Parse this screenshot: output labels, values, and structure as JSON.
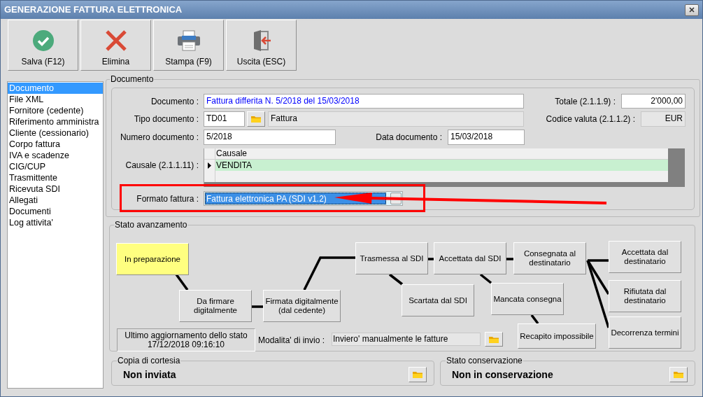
{
  "window": {
    "title": "GENERAZIONE FATTURA ELETTRONICA"
  },
  "toolbar": [
    {
      "label": "Salva (F12)",
      "kind": "save"
    },
    {
      "label": "Elimina",
      "kind": "delete"
    },
    {
      "label": "Stampa (F9)",
      "kind": "print"
    },
    {
      "label": "Uscita (ESC)",
      "kind": "exit"
    }
  ],
  "sidebar": {
    "items": [
      {
        "label": "Documento",
        "selected": true
      },
      {
        "label": "File XML",
        "selected": false
      },
      {
        "label": "Fornitore (cedente)",
        "selected": false
      },
      {
        "label": "Riferimento amministra",
        "selected": false
      },
      {
        "label": "Cliente (cessionario)",
        "selected": false
      },
      {
        "label": "Corpo fattura",
        "selected": false
      },
      {
        "label": "IVA e scadenze",
        "selected": false
      },
      {
        "label": "CIG/CUP",
        "selected": false
      },
      {
        "label": "Trasmittente",
        "selected": false
      },
      {
        "label": "Ricevuta SDI",
        "selected": false
      },
      {
        "label": "Allegati",
        "selected": false
      },
      {
        "label": "Documenti",
        "selected": false
      },
      {
        "label": "Log attivita'",
        "selected": false
      }
    ]
  },
  "documento": {
    "title": "Documento",
    "documento": {
      "label": "Documento :",
      "value": "Fattura differita N. 5/2018 del 15/03/2018"
    },
    "totale": {
      "label": "Totale (2.1.1.9) :",
      "value": "2'000,00"
    },
    "tipo": {
      "label": "Tipo documento :",
      "code": "TD01",
      "description": "Fattura"
    },
    "valuta": {
      "label": "Codice valuta (2.1.1.2) :",
      "value": "EUR"
    },
    "numero": {
      "label": "Numero documento :",
      "value": "5/2018"
    },
    "data": {
      "label": "Data documento :",
      "value": "15/03/2018"
    },
    "causale": {
      "label": "Causale (2.1.1.11) :",
      "column": "Causale",
      "rows": [
        {
          "value": "VENDITA",
          "selected": true
        }
      ]
    },
    "formato": {
      "label": "Formato fattura :",
      "value": "Fattura elettronica PA (SDI v1.2)"
    }
  },
  "stato_avanzamento": {
    "title": "Stato avanzamento",
    "nodes": [
      {
        "label": "In preparazione",
        "current": true
      },
      {
        "label": "Da firmare\ndigitalmente",
        "current": false
      },
      {
        "label": "Firmata digitalmente\n(dal cedente)",
        "current": false
      },
      {
        "label": "Trasmessa al SDI",
        "current": false
      },
      {
        "label": "Accettata dal SDI",
        "current": false
      },
      {
        "label": "Consegnata al\ndestinatario",
        "current": false
      },
      {
        "label": "Scartata dal SDI",
        "current": false
      },
      {
        "label": "Mancata consegna",
        "current": false
      },
      {
        "label": "Recapito impossibile",
        "current": false
      },
      {
        "label": "Accettata dal\ndestinatario",
        "current": false
      },
      {
        "label": "Rifiutata dal\ndestinatario",
        "current": false
      },
      {
        "label": "Decorrenza termini",
        "current": false
      }
    ],
    "last_update": {
      "label": "Ultimo aggiornamento dello stato",
      "value": "17/12/2018 09:16:10"
    },
    "modalita": {
      "label": "Modalita' di invio :",
      "value": "Inviero' manualmente le fatture"
    }
  },
  "copia_cortesia": {
    "title": "Copia di cortesia",
    "value": "Non inviata"
  },
  "stato_conservazione": {
    "title": "Stato conservazione",
    "value": "Non in conservazione"
  }
}
